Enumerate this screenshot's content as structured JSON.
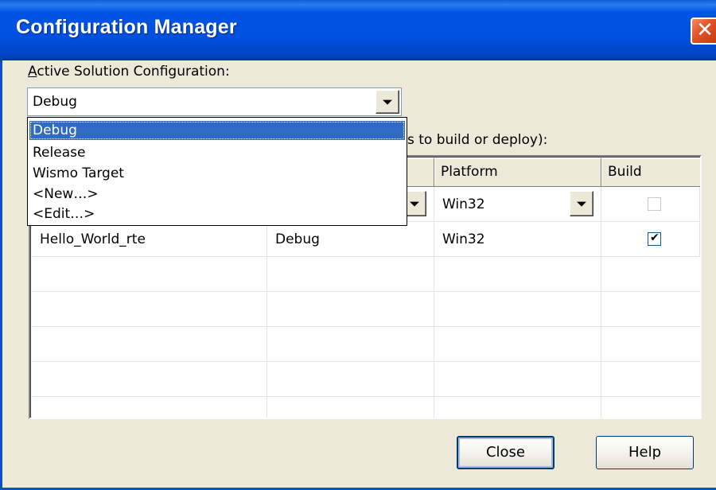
{
  "window": {
    "title": "Configuration Manager"
  },
  "active_config": {
    "label_accel": "A",
    "label_rest": "ctive Solution Configuration:",
    "value": "Debug",
    "options": [
      "Debug",
      "Release",
      "Wismo Target",
      "<New…>",
      "<Edit…>"
    ],
    "selected_index": 0
  },
  "project_contexts": {
    "label_visible": "s to build or deploy):"
  },
  "grid": {
    "columns": {
      "platform": "Platform",
      "build": "Build"
    },
    "rows": [
      {
        "project": "",
        "configuration": "",
        "platform": "Win32",
        "build": false
      },
      {
        "project": "Hello_World_rte",
        "configuration": "Debug",
        "platform": "Win32",
        "build": true
      }
    ]
  },
  "buttons": {
    "close": "Close",
    "help": "Help"
  },
  "icons": {
    "close": "close-icon",
    "dropdown": "chevron-down-icon",
    "check": "checkmark-icon"
  }
}
